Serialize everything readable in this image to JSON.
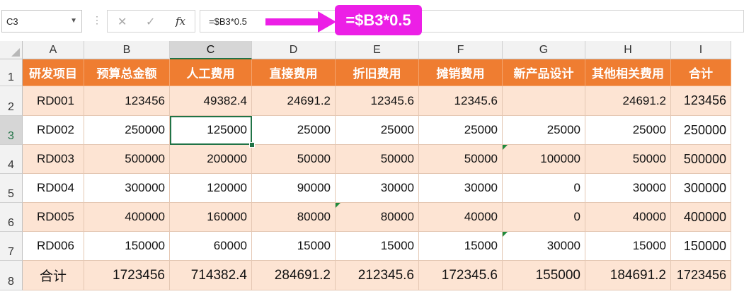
{
  "formula_bar": {
    "name_box": "C3",
    "formula": "=$B3*0.5",
    "cancel_glyph": "✕",
    "enter_glyph": "✓",
    "fx_glyph": "fx"
  },
  "callout": {
    "text": "=$B3*0.5",
    "color": "#ec1fe6"
  },
  "sheet": {
    "selected_cell": "C3",
    "header_color": "#ef7d31",
    "band_color": "#fde4d3",
    "columns": [
      "A",
      "B",
      "C",
      "D",
      "E",
      "F",
      "G",
      "H",
      "I"
    ],
    "row_numbers": [
      "1",
      "2",
      "3",
      "4",
      "5",
      "6",
      "7",
      "8"
    ],
    "headers": [
      "研发项目",
      "预算总金额",
      "人工费用",
      "直接费用",
      "折旧费用",
      "摊销费用",
      "新产品设计",
      "其他相关费用",
      "合计"
    ],
    "rows": [
      [
        "RD001",
        "123456",
        "49382.4",
        "24691.2",
        "12345.6",
        "12345.6",
        "",
        "24691.2",
        "123456"
      ],
      [
        "RD002",
        "250000",
        "125000",
        "25000",
        "25000",
        "25000",
        "25000",
        "25000",
        "250000"
      ],
      [
        "RD003",
        "500000",
        "200000",
        "50000",
        "50000",
        "50000",
        "100000",
        "50000",
        "500000"
      ],
      [
        "RD004",
        "300000",
        "120000",
        "90000",
        "30000",
        "30000",
        "0",
        "30000",
        "300000"
      ],
      [
        "RD005",
        "400000",
        "160000",
        "80000",
        "80000",
        "40000",
        "0",
        "40000",
        "400000"
      ],
      [
        "RD006",
        "150000",
        "60000",
        "15000",
        "15000",
        "15000",
        "30000",
        "15000",
        "150000"
      ],
      [
        "合计",
        "1723456",
        "714382.4",
        "284691.2",
        "212345.6",
        "172345.6",
        "155000",
        "184691.2",
        "1723456"
      ]
    ]
  }
}
